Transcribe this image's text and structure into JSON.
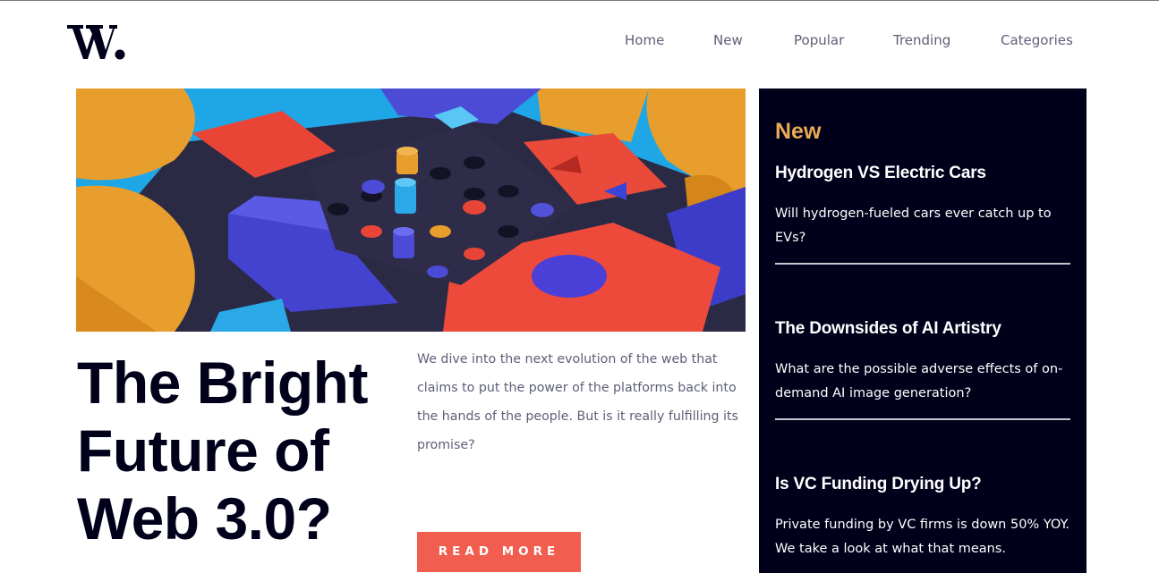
{
  "header": {
    "logo_text": "W.",
    "nav": [
      {
        "label": "Home"
      },
      {
        "label": "New"
      },
      {
        "label": "Popular"
      },
      {
        "label": "Trending"
      },
      {
        "label": "Categories"
      }
    ]
  },
  "main": {
    "title": "The Bright Future of Web 3.0?",
    "description": "We dive into the next evolution of the web that claims to put the power of the platforms back into the hands of the people. But is it really fulfilling its promise?",
    "cta_label": "READ MORE"
  },
  "sidebar": {
    "heading": "New",
    "articles": [
      {
        "title": "Hydrogen VS Electric Cars",
        "summary": "Will hydrogen-fueled cars ever catch up to EVs?"
      },
      {
        "title": "The Downsides of AI Artistry",
        "summary": "What are the possible adverse effects of on-demand AI image generation?"
      },
      {
        "title": "Is VC Funding Drying Up?",
        "summary": "Private funding by VC firms is down 50% YOY. We take a look at what that means."
      }
    ]
  },
  "colors": {
    "accent": "#f15e50",
    "sidebar_bg": "#00001a",
    "sidebar_heading": "#e9ab53",
    "text_dark": "#00001a",
    "text_muted": "#5d5f79"
  }
}
